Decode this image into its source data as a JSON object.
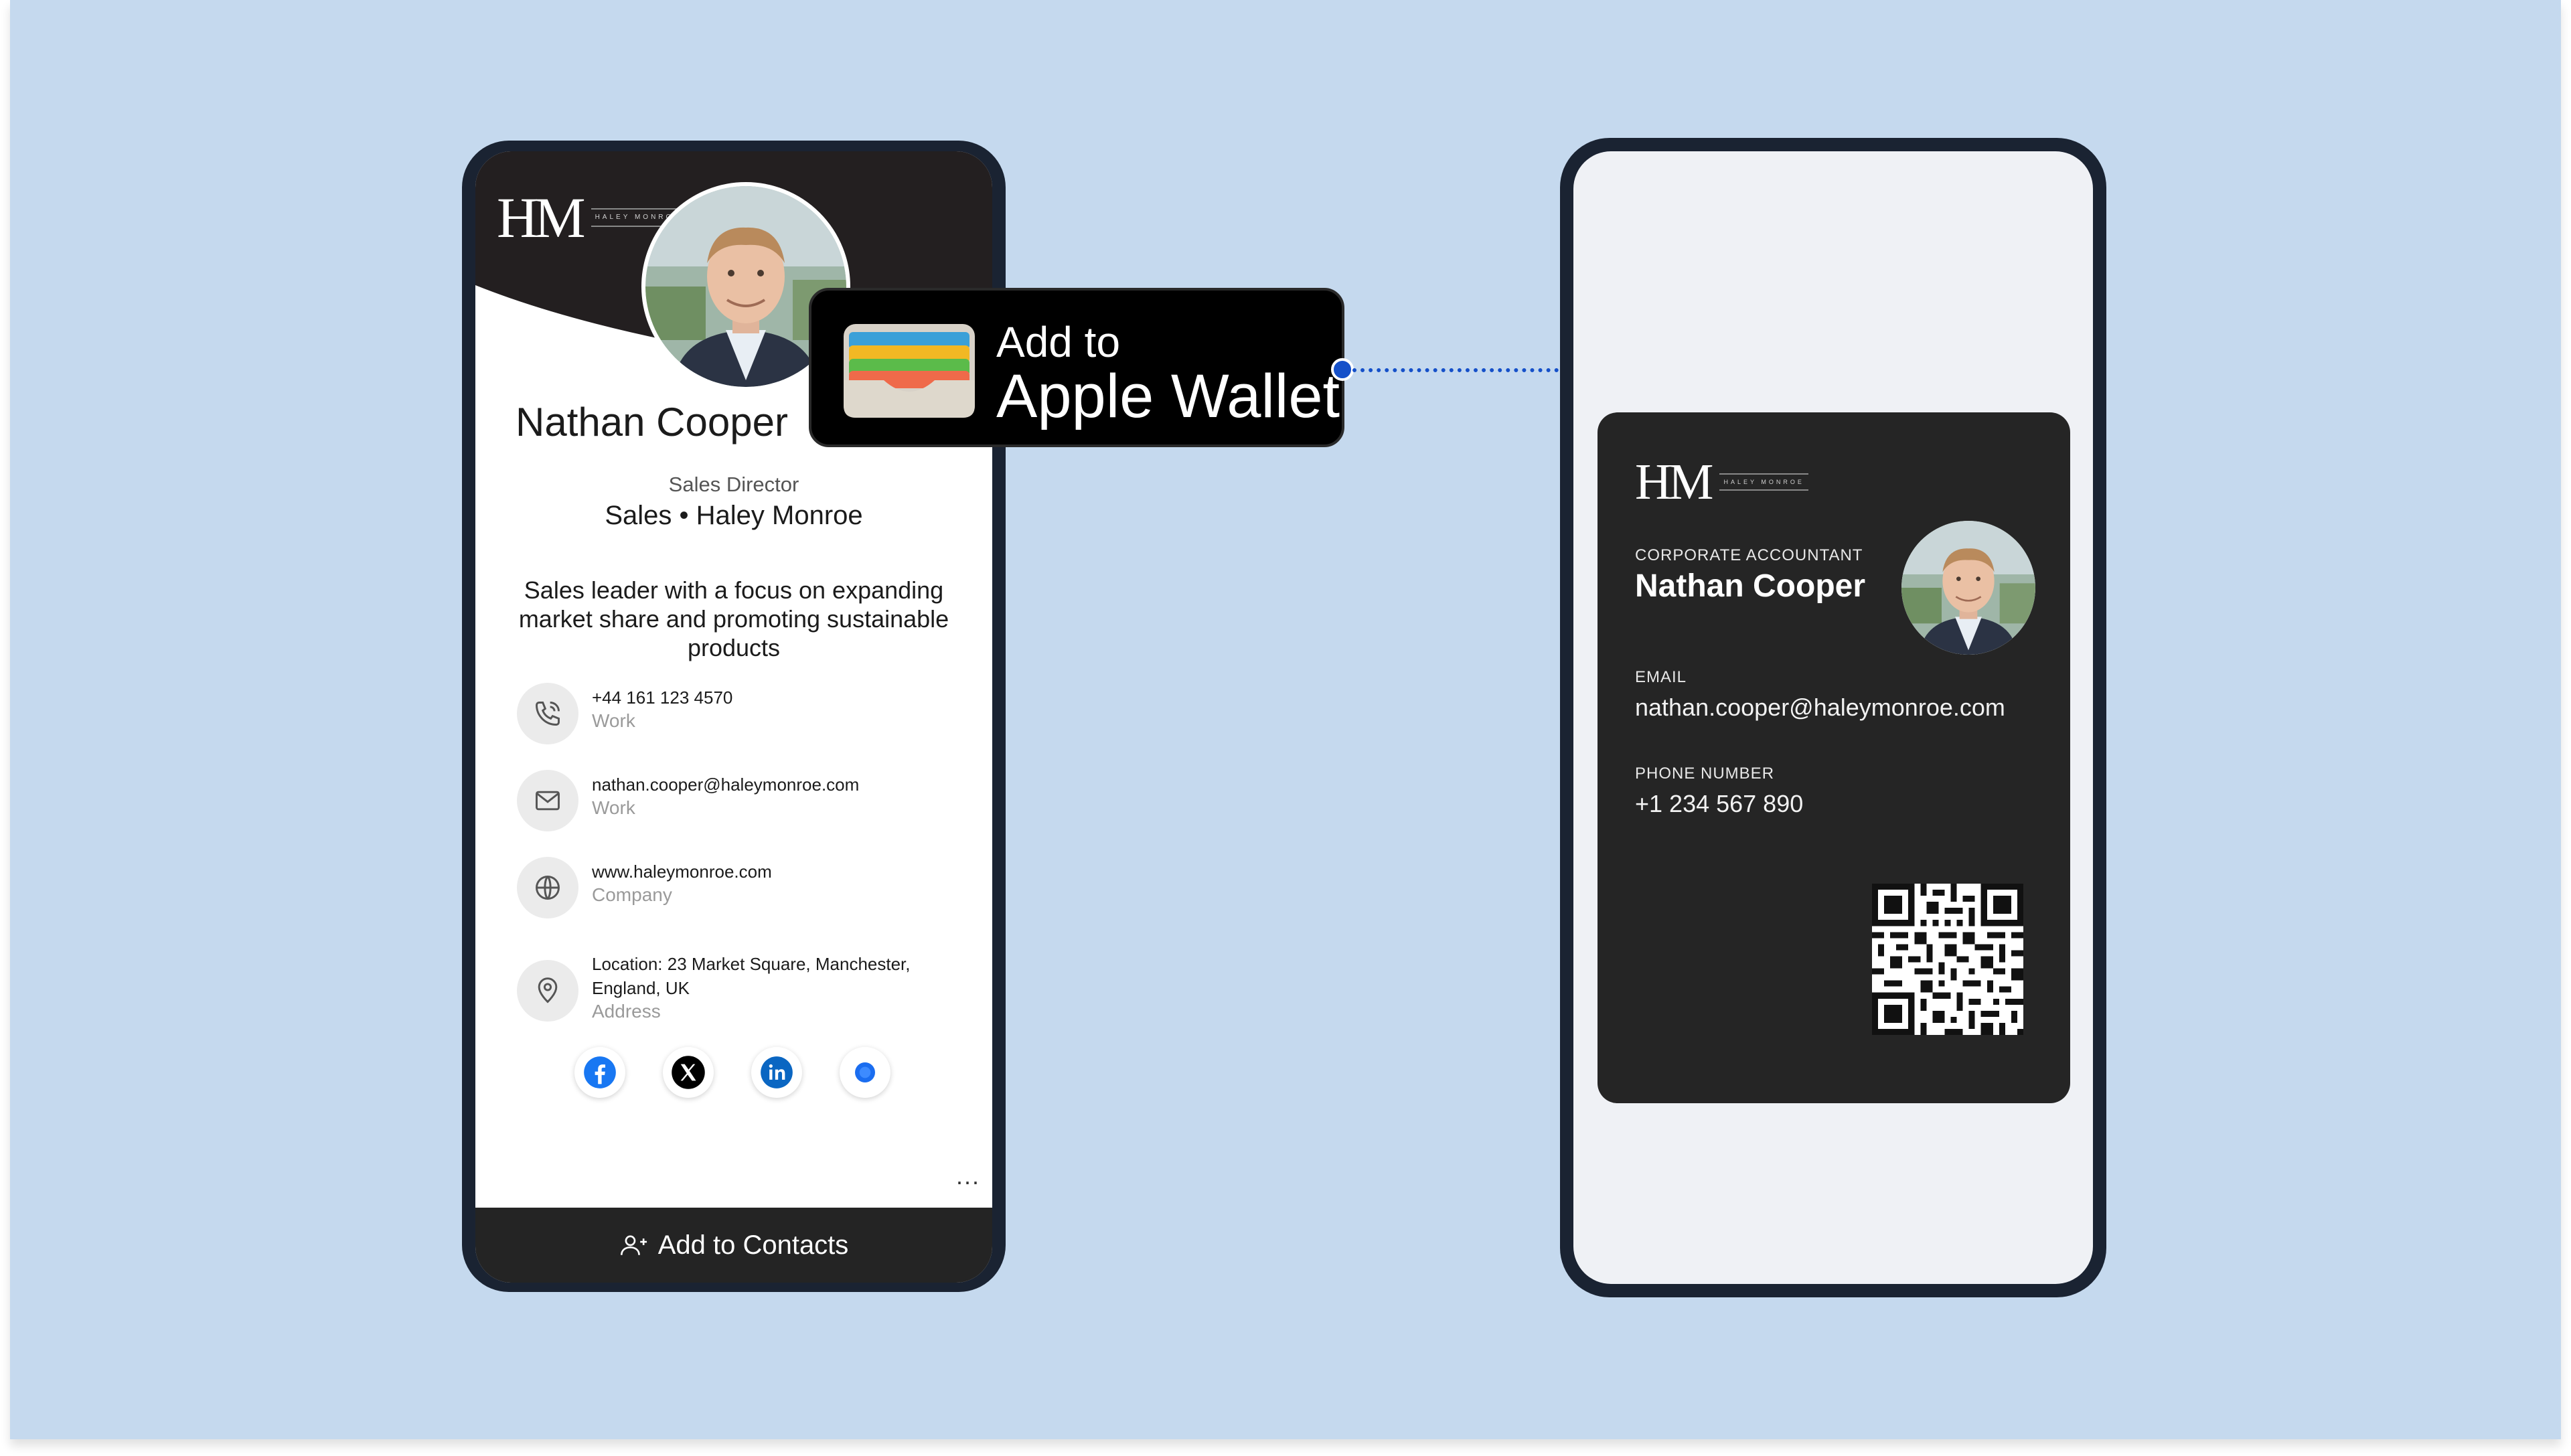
{
  "left_card": {
    "logo_mark": "HM",
    "logo_sub": "HALEY MONROE",
    "name": "Nathan Cooper",
    "job_title": "Sales Director",
    "department_company": "Sales • Haley Monroe",
    "bio": "Sales leader with a focus on expanding market share and promoting sustainable products",
    "contacts": [
      {
        "icon": "phone-icon",
        "value": "+44 161 123 4570",
        "label": "Work"
      },
      {
        "icon": "email-icon",
        "value": "nathan.cooper@haleymonroe.com",
        "label": "Work"
      },
      {
        "icon": "globe-icon",
        "value": "www.haleymonroe.com",
        "label": "Company"
      },
      {
        "icon": "location-pin-icon",
        "value": "Location: 23 Market Square, Manchester, England, UK",
        "label": "Address"
      }
    ],
    "socials": [
      "facebook-icon",
      "x-icon",
      "linkedin-icon",
      "other-social-icon"
    ],
    "more": "...",
    "add_contacts_label": "Add to Contacts"
  },
  "wallet_button": {
    "line1": "Add to",
    "line2": "Apple Wallet"
  },
  "wallet_pass": {
    "logo_mark": "HM",
    "logo_sub": "HALEY MONROE",
    "role_label": "CORPORATE ACCOUNTANT",
    "name": "Nathan Cooper",
    "email_label": "EMAIL",
    "email": "nathan.cooper@haleymonroe.com",
    "phone_label": "PHONE NUMBER",
    "phone": "+1 234 567 890"
  },
  "colors": {
    "background": "#c5d9ee",
    "phone_frame": "#1a2332",
    "card_dark": "#252525",
    "connector_blue": "#1550c9"
  }
}
